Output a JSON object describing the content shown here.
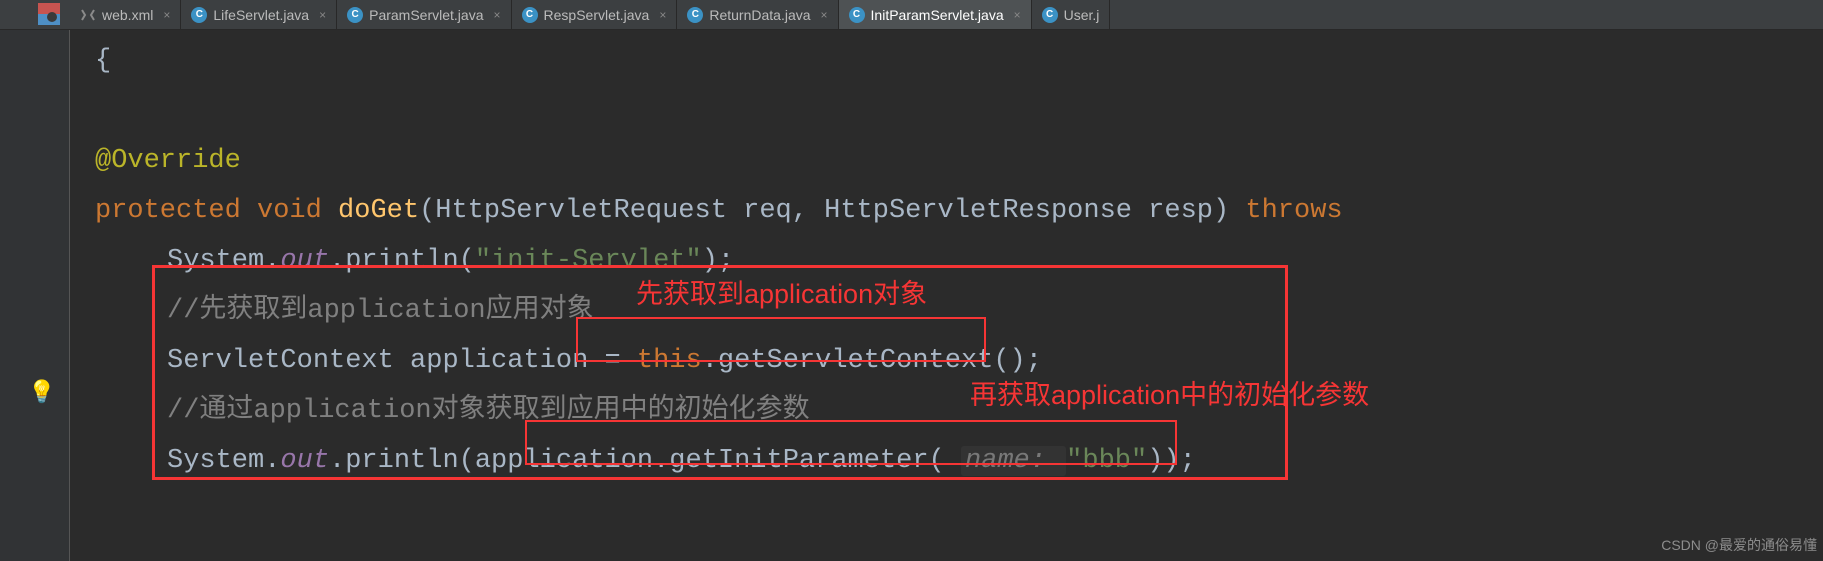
{
  "tabs": [
    {
      "label": "web.xml",
      "type": "xml"
    },
    {
      "label": "LifeServlet.java",
      "type": "java"
    },
    {
      "label": "ParamServlet.java",
      "type": "java"
    },
    {
      "label": "RespServlet.java",
      "type": "java"
    },
    {
      "label": "ReturnData.java",
      "type": "java"
    },
    {
      "label": "InitParamServlet.java",
      "type": "java",
      "active": true
    },
    {
      "label": "User.j",
      "type": "java"
    }
  ],
  "code": {
    "brace": "{",
    "annotation": "@Override",
    "kw_protected": "protected",
    "kw_void": "void",
    "method_doGet": "doGet",
    "params_sig": "(HttpServletRequest req, HttpServletResponse resp) ",
    "kw_throws": "throws",
    "system": "System",
    "dot": ".",
    "out": "out",
    "println": "println",
    "open_paren": "(",
    "close_paren": ")",
    "semi": ";",
    "str_init": "\"init-Servlet\"",
    "comment1": "//先获取到application应用对象",
    "ctx_type": "ServletContext application = ",
    "kw_this": "this",
    "getctx": ".getServletContext();",
    "comment2": "//通过application对象获取到应用中的初始化参数",
    "app_getinit": "application.getInitParameter( ",
    "name_hint": "name: ",
    "str_bbb": "\"bbb\"",
    "close2": "));"
  },
  "annotations": {
    "a1": "先获取到application对象",
    "a2": "再获取application中的初始化参数"
  },
  "watermark": "CSDN @最爱的通俗易懂"
}
